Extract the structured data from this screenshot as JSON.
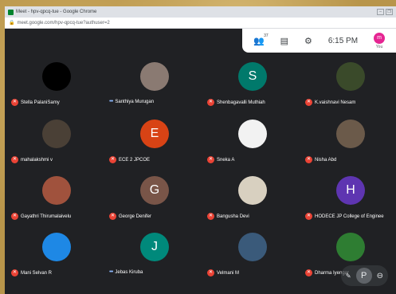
{
  "browser": {
    "tab_title": "Meet - hpv-qpcq-tue - Google Chrome",
    "url": "meet.google.com/hpv-qpcq-tue?authuser=2"
  },
  "topbar": {
    "participants_count": "37",
    "time": "6:15 PM",
    "you_initial": "m",
    "you_label": "You"
  },
  "participants": [
    {
      "name": "Stella PalaniSamy",
      "initial": "",
      "color": "#000000",
      "muted": true
    },
    {
      "name": "Santhiya Murugan",
      "initial": "",
      "color": "#8a7a72",
      "muted": false
    },
    {
      "name": "Shenbagavalli Muthiah",
      "initial": "S",
      "color": "#00796b",
      "muted": true
    },
    {
      "name": "K.vaishnavi Nesam",
      "initial": "",
      "color": "#3a4a2a",
      "muted": true
    },
    {
      "name": "mahalakshmi v",
      "initial": "",
      "color": "#4a4036",
      "muted": true
    },
    {
      "name": "ECE 2 JPCOE",
      "initial": "E",
      "color": "#d84315",
      "muted": true
    },
    {
      "name": "Sneka A",
      "initial": "",
      "color": "#f2f2f2",
      "muted": true
    },
    {
      "name": "Nisha Abd",
      "initial": "",
      "color": "#6b5a4a",
      "muted": true
    },
    {
      "name": "Gayathri Thirumalaivelu",
      "initial": "",
      "color": "#a0523d",
      "muted": true
    },
    {
      "name": "George Denifer",
      "initial": "G",
      "color": "#795548",
      "muted": true
    },
    {
      "name": "Bangusha Devi",
      "initial": "",
      "color": "#d8d0c0",
      "muted": true
    },
    {
      "name": "HODECE JP College of Enginee",
      "initial": "H",
      "color": "#5e35b1",
      "muted": true
    },
    {
      "name": "Mani Selvan R",
      "initial": "",
      "color": "#1e88e5",
      "muted": true
    },
    {
      "name": "Jebas Kiruba",
      "initial": "J",
      "color": "#00897b",
      "muted": false
    },
    {
      "name": "Velmani M",
      "initial": "",
      "color": "#3a5a7a",
      "muted": true
    },
    {
      "name": "Dharma Iyengar",
      "initial": "",
      "color": "#2e7d32",
      "muted": true
    }
  ],
  "floating": {
    "initial": "P"
  }
}
